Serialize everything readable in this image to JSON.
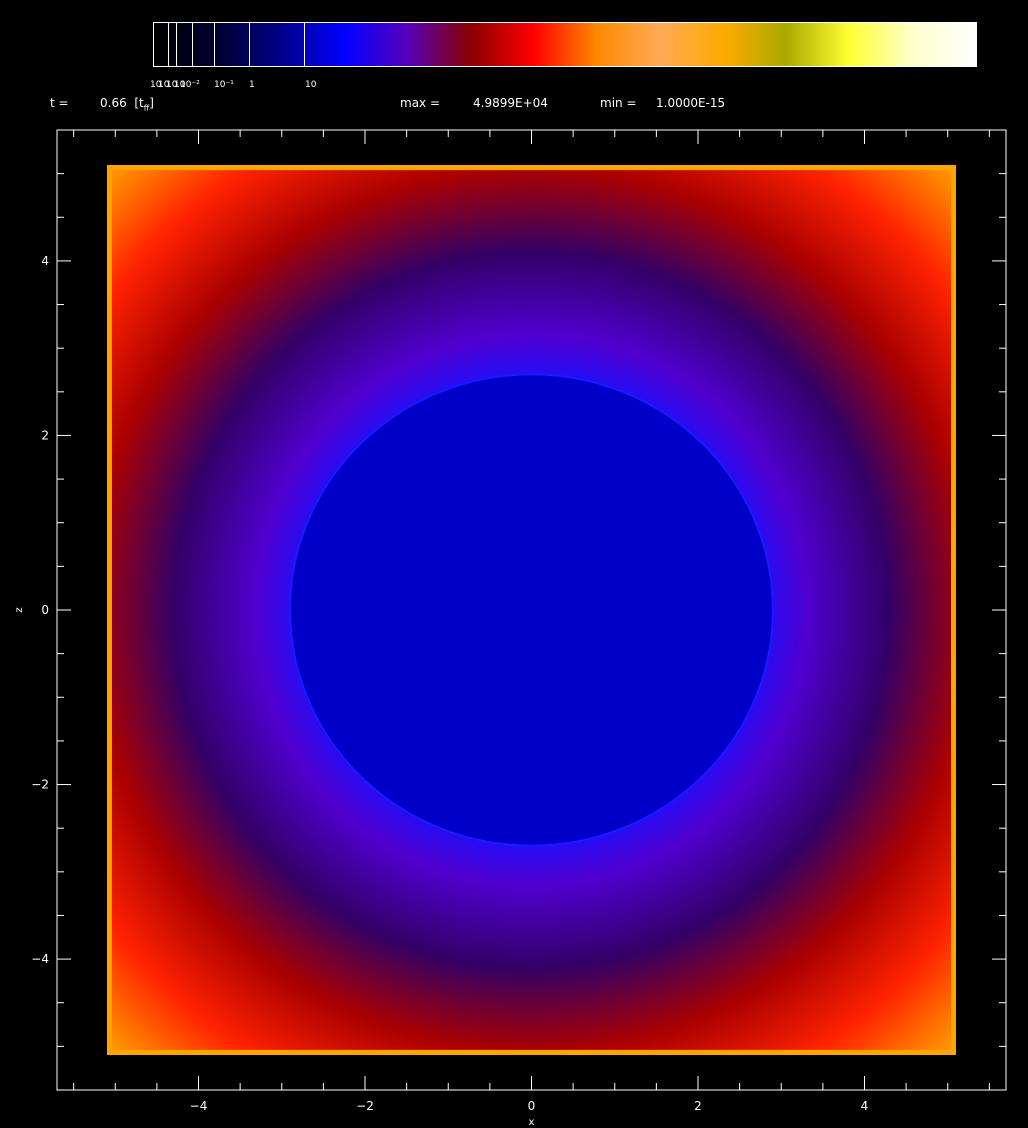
{
  "header": {
    "time_label": "t =",
    "time_value": "0.66",
    "time_unit": "[t",
    "time_unit_sub": "ff",
    "time_unit_close": "]",
    "max_label": "max =",
    "max_value": "4.9899E+04",
    "min_label": "min =",
    "min_value": "1.0000E-15"
  },
  "colorbar": {
    "tick_labels": [
      "10",
      "10",
      "10",
      "10",
      "10⁻²",
      "10⁻¹",
      "1",
      "10"
    ],
    "colors": [
      "#000000",
      "#000030",
      "#000088",
      "#0000ff",
      "#5500bb",
      "#880000",
      "#ff0000",
      "#ff8800",
      "#ffaa55",
      "#ffaa00",
      "#aaaa00",
      "#ffff33",
      "#ffffcc",
      "#ffffff"
    ]
  },
  "chart_data": {
    "type": "heatmap",
    "title": "",
    "xlabel": "x",
    "ylabel": "z",
    "xlim": [
      -5.7,
      5.7
    ],
    "ylim": [
      -5.5,
      5.5
    ],
    "domain": [
      -5.1,
      5.1
    ],
    "xticks": [
      -4,
      -2,
      0,
      2,
      4
    ],
    "yticks": [
      -4,
      -2,
      0,
      2,
      4
    ],
    "xtick_labels": [
      "−4",
      "−2",
      "0",
      "2",
      "4"
    ],
    "ytick_labels": [
      "−4",
      "−2",
      "0",
      "2",
      "4"
    ],
    "minor_tick_step": 0.5,
    "inner_region": {
      "shape": "rounded-disk",
      "center": [
        0,
        0
      ],
      "radius_x": 2.9,
      "radius_z": 2.7,
      "color": "#0000c8"
    },
    "radial_colormap": [
      {
        "r": 2.7,
        "color": "#1a10ff"
      },
      {
        "r": 3.3,
        "color": "#5000d0"
      },
      {
        "r": 4.3,
        "color": "#330066"
      },
      {
        "r": 5.3,
        "color": "#aa0000"
      },
      {
        "r": 6.3,
        "color": "#ff2200"
      },
      {
        "r": 7.3,
        "color": "#ff9900"
      }
    ],
    "boundary_color": "#ffa500"
  }
}
